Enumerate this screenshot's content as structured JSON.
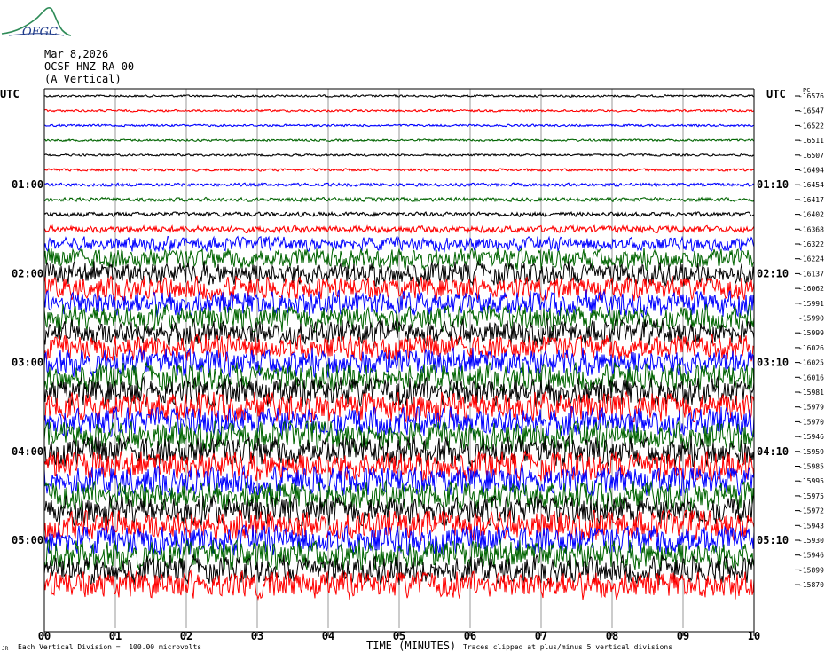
{
  "logo_text": "OFGC",
  "header": {
    "date": "Mar 8,2026",
    "station": "OCSF HNZ RA 00",
    "component": "(A Vertical)"
  },
  "utc_left": "UTC",
  "utc_right": "UTC",
  "right_top_label": "PC",
  "footer": {
    "credit": "JR",
    "scale": "Each Vertical Division =  100.00 microvolts",
    "xlabel": "TIME (MINUTES)",
    "clip": "Traces clipped at plus/minus 5 vertical divisions"
  },
  "chart_data": {
    "type": "line",
    "title": "",
    "xlabel": "TIME (MINUTES)",
    "xlim": [
      0,
      10
    ],
    "x_ticks": [
      "00",
      "01",
      "02",
      "03",
      "04",
      "05",
      "06",
      "07",
      "08",
      "09",
      "10"
    ],
    "left_hour_labels": [
      {
        "row": 6,
        "label": "01:00"
      },
      {
        "row": 12,
        "label": "02:00"
      },
      {
        "row": 18,
        "label": "03:00"
      },
      {
        "row": 24,
        "label": "04:00"
      },
      {
        "row": 30,
        "label": "05:00"
      }
    ],
    "right_hour_labels": [
      {
        "row": 6,
        "label": "01:10"
      },
      {
        "row": 12,
        "label": "02:10"
      },
      {
        "row": 18,
        "label": "03:10"
      },
      {
        "row": 24,
        "label": "04:10"
      },
      {
        "row": 30,
        "label": "05:10"
      }
    ],
    "trace_colors": [
      "#000000",
      "#ff0000",
      "#0000ff",
      "#006400"
    ],
    "trace_offsets": [
      -16576,
      -16547,
      -16522,
      -16511,
      -16507,
      -16494,
      -16454,
      -16417,
      -16402,
      -16368,
      -16322,
      -16224,
      -16137,
      -16062,
      -15991,
      -15990,
      -15999,
      -16026,
      -16025,
      -16016,
      -15981,
      -15979,
      -15970,
      -15946,
      -15959,
      -15985,
      -15995,
      -15975,
      -15972,
      -15943,
      -15930,
      -15946,
      -15899,
      -15870
    ],
    "trace_amplitude": [
      1,
      1,
      1,
      1,
      1,
      1.2,
      1.5,
      1.8,
      2,
      3,
      6,
      9,
      10,
      10,
      11,
      11,
      11,
      11,
      12,
      12,
      13,
      13,
      13,
      13,
      13,
      13,
      13,
      13,
      13,
      13,
      13,
      13,
      12,
      12
    ],
    "clip_divisions": 5,
    "units": "microvolts",
    "division_microvolts": 100.0
  }
}
